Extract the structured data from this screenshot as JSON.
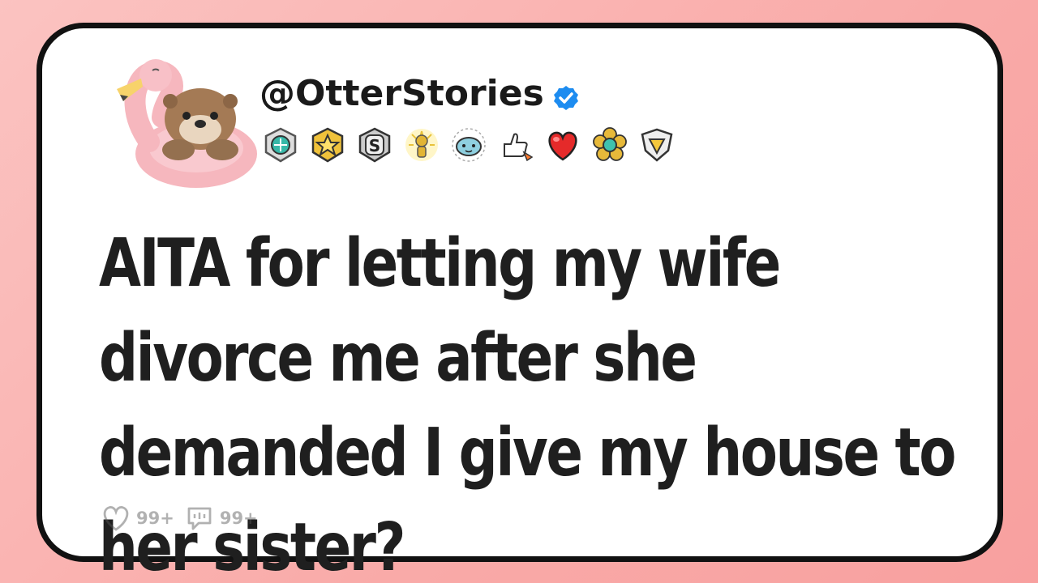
{
  "post": {
    "username": "@OtterStories",
    "verified": true,
    "title": "AITA for letting my wife divorce me after she demanded I give my house to her sister?",
    "likes": "99+",
    "comments": "99+"
  },
  "badges": [
    {
      "icon": "teal-gem-badge-icon"
    },
    {
      "icon": "gold-star-badge-icon"
    },
    {
      "icon": "silver-s-badge-icon"
    },
    {
      "icon": "gold-trophy-badge-icon"
    },
    {
      "icon": "blue-dolphin-badge-icon"
    },
    {
      "icon": "thumbs-up-rocket-badge-icon"
    },
    {
      "icon": "heart-badge-icon"
    },
    {
      "icon": "gold-flower-badge-icon"
    },
    {
      "icon": "gold-diamond-shield-badge-icon"
    }
  ],
  "colors": {
    "background": "#f9aaa8",
    "card": "#ffffff",
    "border": "#111111",
    "text": "#1f1f1f",
    "verified": "#1d8cf0"
  }
}
